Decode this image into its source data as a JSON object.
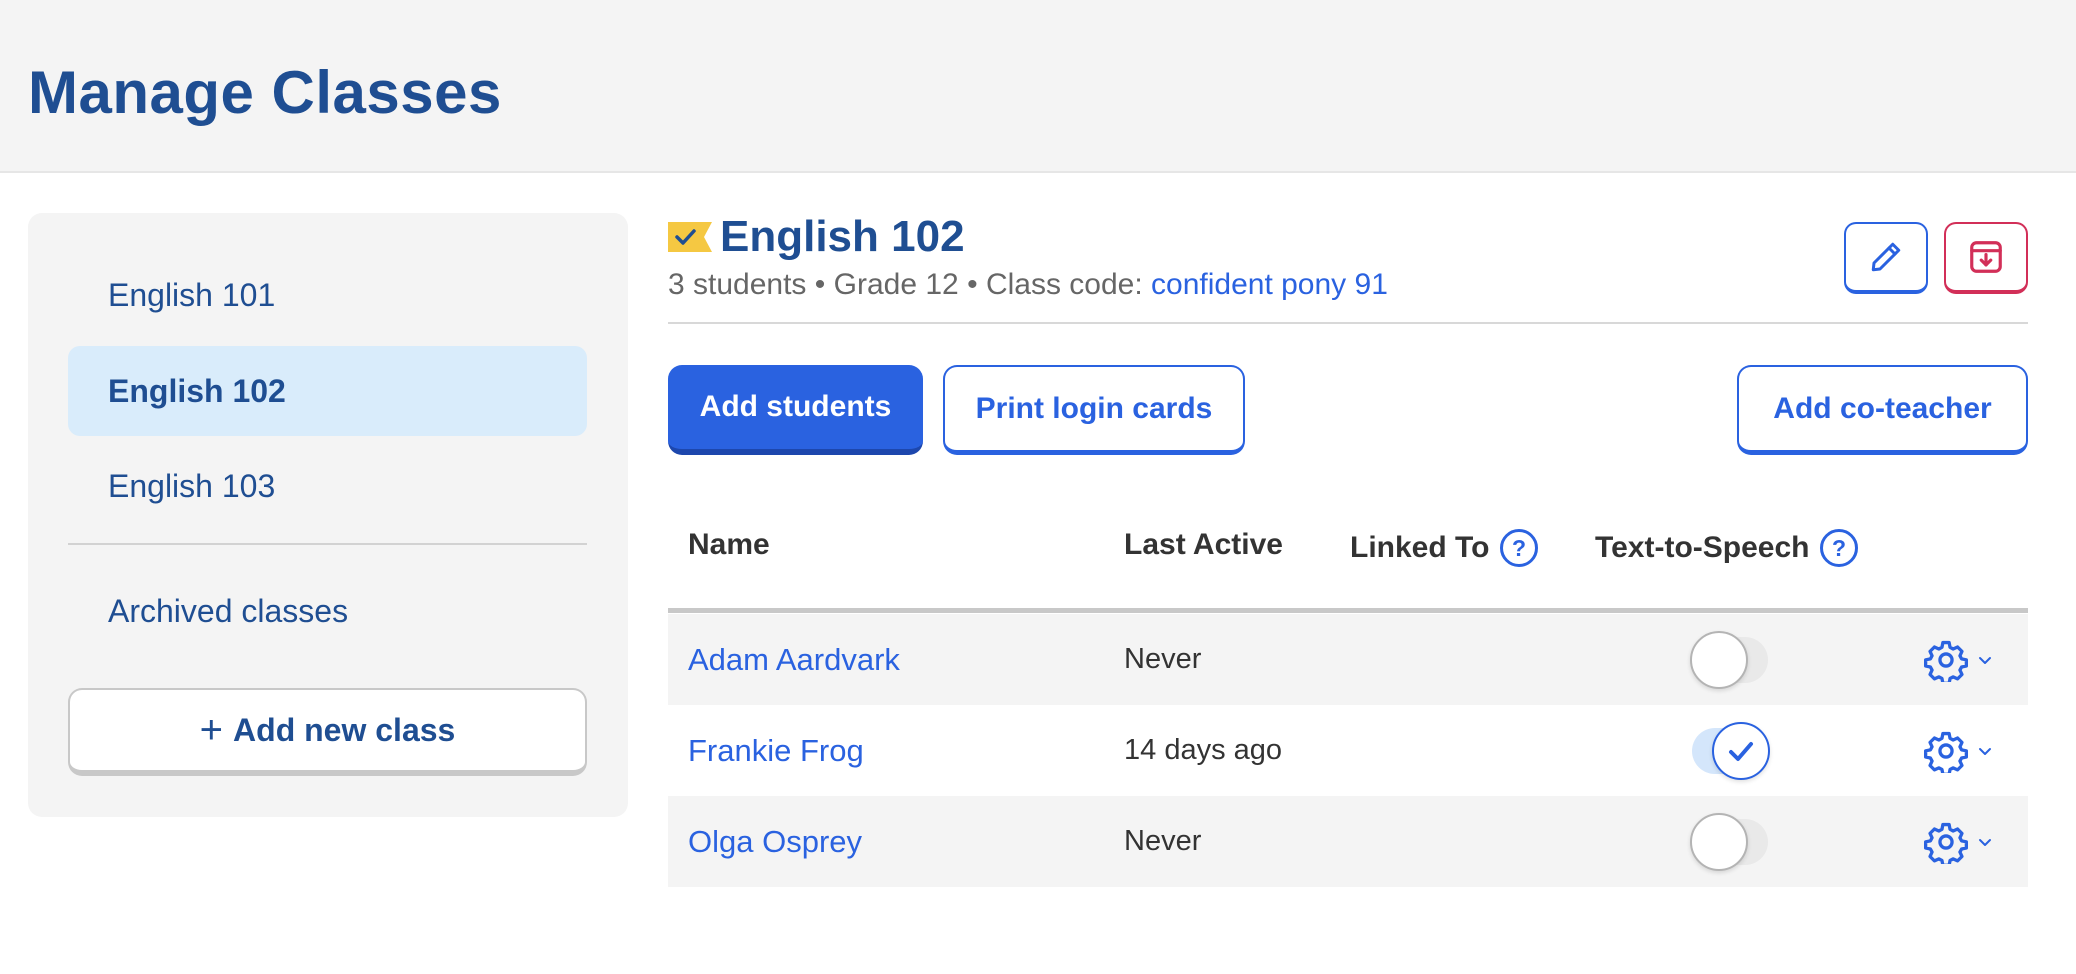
{
  "page": {
    "title": "Manage Classes"
  },
  "sidebar": {
    "classes": [
      {
        "label": "English 101"
      },
      {
        "label": "English 102"
      },
      {
        "label": "English 103"
      }
    ],
    "active_class": "English 102",
    "archived_label": "Archived classes",
    "add_class_plus": "+",
    "add_class_label": "Add new class"
  },
  "class_header": {
    "title": "English 102",
    "students": "3 students",
    "separator": "•",
    "grade": "Grade 12",
    "code_label": "Class code:",
    "code_value": "confident pony 91",
    "icons": {
      "flag": "class-flag-check-icon",
      "edit": "pencil-icon",
      "archive": "archive-box-icon"
    }
  },
  "actions": {
    "add_students": "Add students",
    "print_login_cards": "Print login cards",
    "add_co_teacher": "Add co-teacher"
  },
  "table": {
    "columns": {
      "name": "Name",
      "last_active": "Last Active",
      "linked_to": "Linked To",
      "text_to_speech": "Text-to-Speech",
      "help_icon": "question-circle-icon"
    },
    "rows": [
      {
        "name": "Adam Aardvark",
        "last_active": "Never",
        "linked_to": "",
        "tts_enabled": false
      },
      {
        "name": "Frankie Frog",
        "last_active": "14 days ago",
        "linked_to": "",
        "tts_enabled": true
      },
      {
        "name": "Olga Osprey",
        "last_active": "Never",
        "linked_to": "",
        "tts_enabled": false
      }
    ],
    "row_menu_icons": [
      "gear-icon",
      "chevron-down-icon"
    ]
  },
  "colors": {
    "brand_navy": "#1f4e92",
    "primary_blue": "#2a62e0",
    "danger_red": "#d22f58",
    "flag_yellow": "#f5c842",
    "active_bg": "#d9ecfb",
    "panel_gray": "#f4f4f4"
  }
}
